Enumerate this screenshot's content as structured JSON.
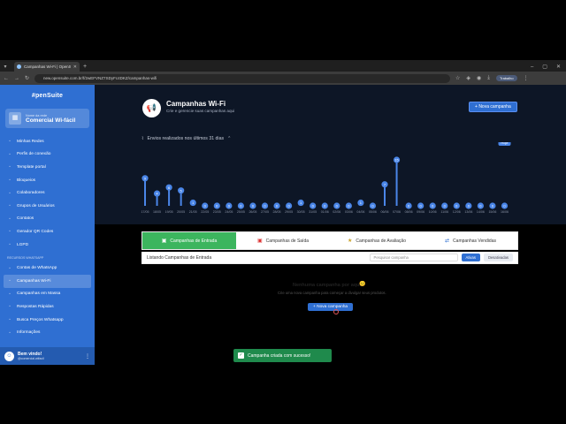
{
  "browser": {
    "tab_title": "Campanhas Wi-Fi | OpenSuite",
    "url": "new.opensuite.com.br/f/2wEFVNZ7SDyFc4DKZ/campanhas-wifi",
    "profile": "Trabalho"
  },
  "sidebar": {
    "logo": "#penSuite",
    "company_label": "Nome da rede",
    "company_name": "Comercial Wi-fácil",
    "items": [
      {
        "label": "Minhas Redes",
        "icon": "wifi-icon"
      },
      {
        "label": "Perfis de conexão",
        "icon": "profile-icon"
      },
      {
        "label": "Template portal",
        "icon": "template-icon"
      },
      {
        "label": "Bloqueios",
        "icon": "block-icon"
      },
      {
        "label": "Colaboradores",
        "icon": "users-icon"
      },
      {
        "label": "Grupos de Usuários",
        "icon": "group-icon"
      },
      {
        "label": "Contatos",
        "icon": "contact-icon"
      },
      {
        "label": "Gerador QR Codes",
        "icon": "qr-icon"
      },
      {
        "label": "LGPD",
        "icon": "doc-icon"
      }
    ],
    "section_label": "RECURSOS WHATSAPP",
    "items2": [
      {
        "label": "Contas de WhatsApp",
        "icon": "whatsapp-icon"
      },
      {
        "label": "Campanhas Wi-Fi",
        "icon": "campaign-icon"
      },
      {
        "label": "Campanhas em Massa",
        "icon": "mass-icon"
      },
      {
        "label": "Respostas Rápidas",
        "icon": "reply-icon"
      },
      {
        "label": "Busca Preços Whatsapp",
        "icon": "price-icon"
      },
      {
        "label": "Informações",
        "icon": "info-icon"
      }
    ],
    "user_greeting": "Bem vindo!",
    "user_email": "@comercial.wifacil"
  },
  "header": {
    "title": "Campanhas Wi-Fi",
    "subtitle": "Crie e gerencie suas campanhas aqui",
    "new_button": "Nova campanha",
    "chart_title": "Envios realizados nos últimos 31 dias"
  },
  "chart_data": {
    "type": "bar",
    "title": "Envios realizados nos últimos 31 dias",
    "categories": [
      "17/05",
      "18/05",
      "19/05",
      "20/05",
      "21/05",
      "22/05",
      "23/05",
      "24/05",
      "25/05",
      "26/05",
      "27/05",
      "28/05",
      "29/05",
      "30/05",
      "31/05",
      "01/06",
      "02/06",
      "03/06",
      "04/06",
      "05/06",
      "06/06",
      "07/06",
      "08/06",
      "09/06",
      "10/06",
      "11/06",
      "12/06",
      "13/06",
      "14/06",
      "15/06",
      "16/06"
    ],
    "values": [
      9,
      4,
      6,
      5,
      1,
      0,
      0,
      0,
      0,
      0,
      0,
      0,
      0,
      1,
      0,
      0,
      0,
      0,
      1,
      0,
      7,
      15,
      0,
      0,
      0,
      0,
      0,
      0,
      0,
      0,
      0
    ],
    "today_label": "Hoje"
  },
  "tabs": [
    {
      "label": "Campanhas de Entrada",
      "icon": "entry-icon",
      "active": true
    },
    {
      "label": "Campanhas de Saída",
      "icon": "exit-icon",
      "active": false
    },
    {
      "label": "Campanhas de Avaliação",
      "icon": "star-icon",
      "active": false
    },
    {
      "label": "Campanhas Vendidas",
      "icon": "sold-icon",
      "active": false
    }
  ],
  "list": {
    "title": "Listando Campanhas de Entrada",
    "search_placeholder": "Pesquisar campanha",
    "filter_active": "Ativas",
    "filter_inactive": "Desativadas"
  },
  "empty": {
    "title": "Nenhuma campanha por aqui.",
    "subtitle": "Crie uma nova campanha para começar a divulgar seus produtos.",
    "button": "Nova campanha"
  },
  "toast": "Campanha criada com sucesso!"
}
